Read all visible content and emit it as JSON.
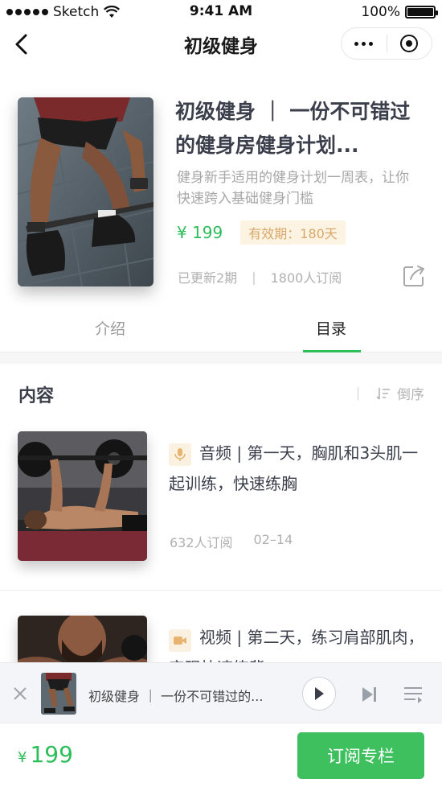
{
  "status_bar": {
    "carrier": "Sketch",
    "time": "9:41 AM",
    "battery": "100%"
  },
  "nav": {
    "title": "初级健身"
  },
  "course": {
    "title": "初级健身 ｜ 一份不可错过的健身房健身计划...",
    "description": "健身新手适用的健身计划一周表，让你快速跨入基础健身门槛",
    "price": "¥ 199",
    "validity": "有效期：180天",
    "updated": "已更新2期",
    "separator": "|",
    "subscribers": "1800人订阅"
  },
  "tabs": [
    {
      "label": "介绍",
      "active": false
    },
    {
      "label": "目录",
      "active": true
    }
  ],
  "section": {
    "title": "内容",
    "sort_label": "倒序"
  },
  "items": [
    {
      "type_icon": "microphone-icon",
      "title": "音频 | 第一天，胸肌和3头肌一起训练，快速练胸",
      "subscribers": "632人订阅",
      "date": "02–14"
    },
    {
      "type_icon": "video-icon",
      "title": "视频 | 第二天，练习肩部肌肉，实现快速练背",
      "subscribers": "",
      "date": ""
    }
  ],
  "player": {
    "title": "初级健身 ｜ 一份不可错过的..."
  },
  "bottom": {
    "price_symbol": "¥",
    "price": "199",
    "subscribe_label": "订阅专栏"
  },
  "colors": {
    "accent": "#2dbd5a",
    "button": "#3ec05f",
    "validity_bg": "#fdf3e2",
    "validity_text": "#d7a86a"
  }
}
